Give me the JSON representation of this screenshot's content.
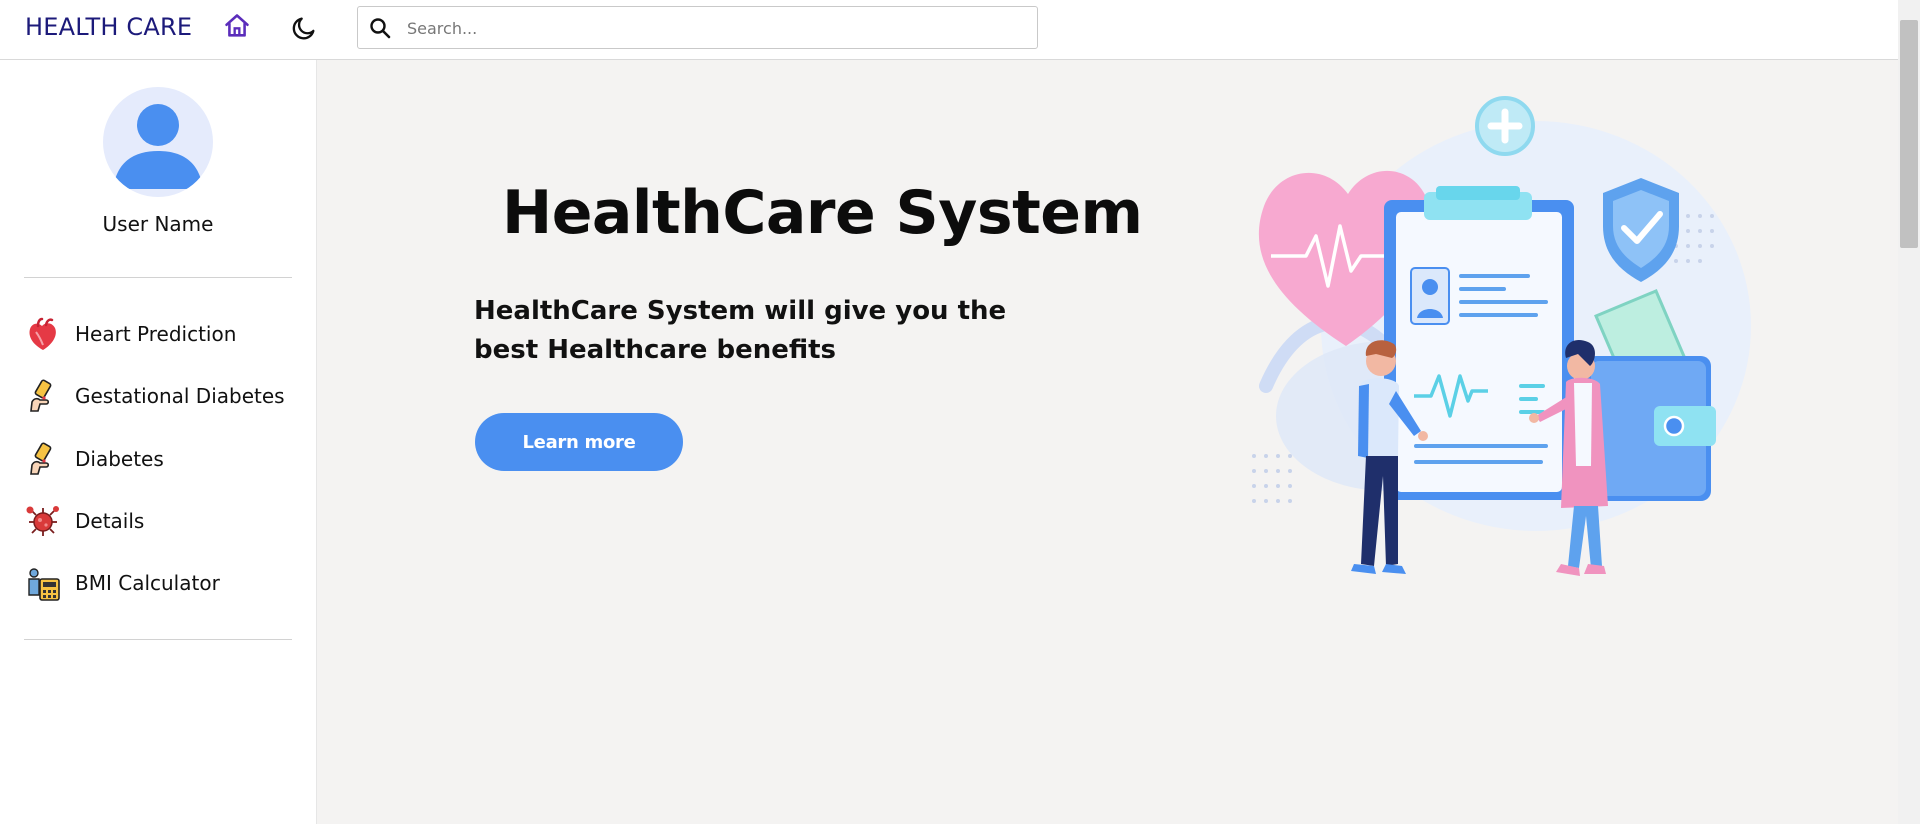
{
  "header": {
    "brand": "HEALTH CARE",
    "home_icon": "home-icon",
    "theme_icon": "moon-icon",
    "search": {
      "placeholder": "Search...",
      "value": ""
    }
  },
  "sidebar": {
    "user_name": "User Name",
    "items": [
      {
        "label": "Heart Prediction",
        "icon": "heart-organ-icon"
      },
      {
        "label": "Gestational Diabetes",
        "icon": "glucose-test-icon"
      },
      {
        "label": "Diabetes",
        "icon": "glucose-test-icon"
      },
      {
        "label": "Details",
        "icon": "virus-icon"
      },
      {
        "label": "BMI Calculator",
        "icon": "bmi-scale-icon"
      }
    ]
  },
  "hero": {
    "title": "HealthCare System",
    "subtitle": "HealthCare System will give you the best Healthcare benefits",
    "button_label": "Learn more"
  },
  "colors": {
    "brand": "#1c1a7a",
    "accent": "#4a8ff0",
    "home_icon": "#5b2dbb",
    "main_bg": "#f4f3f2"
  }
}
